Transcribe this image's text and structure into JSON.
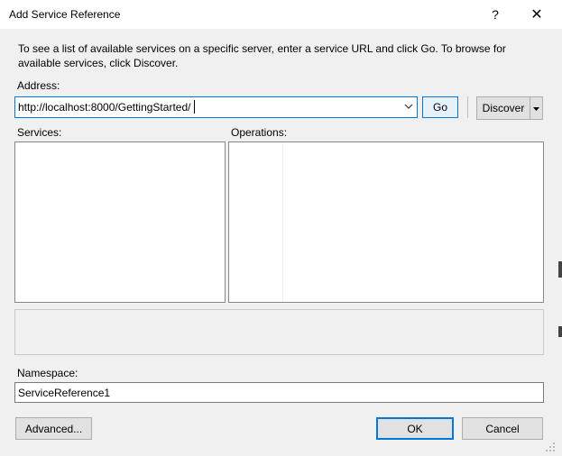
{
  "window": {
    "title": "Add Service Reference",
    "help_glyph": "?",
    "close_glyph": "✕"
  },
  "description": "To see a list of available services on a specific server, enter a service URL and click Go. To browse for available services, click Discover.",
  "address": {
    "label": "Address:",
    "value": "http://localhost:8000/GettingStarted/",
    "go_label": "Go",
    "discover_label": "Discover"
  },
  "services": {
    "label": "Services:"
  },
  "operations": {
    "label": "Operations:"
  },
  "namespace": {
    "label": "Namespace:",
    "value": "ServiceReference1"
  },
  "buttons": {
    "advanced": "Advanced...",
    "ok": "OK",
    "cancel": "Cancel"
  },
  "colors": {
    "accent": "#0078d7",
    "dialog_bg": "#f0f0f0",
    "titlebar_bg": "#ffffff"
  },
  "icons": {
    "address_dropdown": "chevron-down-icon",
    "discover_dropdown": "caret-down-icon",
    "resize": "resize-grip-icon"
  }
}
